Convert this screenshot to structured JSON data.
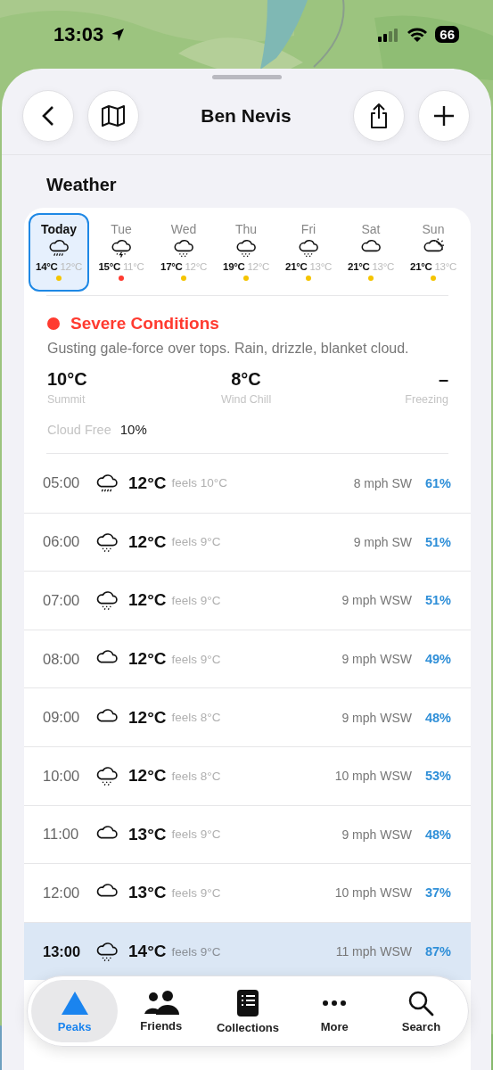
{
  "status_bar": {
    "time": "13:03",
    "battery": "66"
  },
  "header": {
    "title": "Ben Nevis"
  },
  "section_title": "Weather",
  "days": [
    {
      "label": "Today",
      "kind": "rain",
      "high": "14°C",
      "low": "12°C",
      "color": "#f5c400",
      "selected": true
    },
    {
      "label": "Tue",
      "kind": "thunder",
      "high": "15°C",
      "low": "11°C",
      "color": "#ff3b30",
      "selected": false
    },
    {
      "label": "Wed",
      "kind": "drizzle",
      "high": "17°C",
      "low": "12°C",
      "color": "#f5c400",
      "selected": false
    },
    {
      "label": "Thu",
      "kind": "drizzle",
      "high": "19°C",
      "low": "12°C",
      "color": "#f5c400",
      "selected": false
    },
    {
      "label": "Fri",
      "kind": "drizzle",
      "high": "21°C",
      "low": "13°C",
      "color": "#f5c400",
      "selected": false
    },
    {
      "label": "Sat",
      "kind": "cloud",
      "high": "21°C",
      "low": "13°C",
      "color": "#f5c400",
      "selected": false
    },
    {
      "label": "Sun",
      "kind": "partly-sunny",
      "high": "21°C",
      "low": "13°C",
      "color": "#f5c400",
      "selected": false
    }
  ],
  "conditions": {
    "title": "Severe Conditions",
    "color": "#ff3b30",
    "description": "Gusting gale-force over tops. Rain, drizzle, blanket cloud.",
    "stats": [
      {
        "value": "10°C",
        "label": "Summit"
      },
      {
        "value": "8°C",
        "label": "Wind Chill"
      },
      {
        "value": "–",
        "label": "Freezing"
      }
    ],
    "cloud_free_label": "Cloud Free",
    "cloud_free_value": "10%"
  },
  "hours": [
    {
      "time": "05:00",
      "kind": "rain",
      "temp": "12°C",
      "feels": "feels 10°C",
      "wind": "8 mph SW",
      "chance": "61%",
      "selected": false
    },
    {
      "time": "06:00",
      "kind": "drizzle",
      "temp": "12°C",
      "feels": "feels 9°C",
      "wind": "9 mph SW",
      "chance": "51%",
      "selected": false
    },
    {
      "time": "07:00",
      "kind": "drizzle",
      "temp": "12°C",
      "feels": "feels 9°C",
      "wind": "9 mph WSW",
      "chance": "51%",
      "selected": false
    },
    {
      "time": "08:00",
      "kind": "cloud",
      "temp": "12°C",
      "feels": "feels 9°C",
      "wind": "9 mph WSW",
      "chance": "49%",
      "selected": false
    },
    {
      "time": "09:00",
      "kind": "cloud",
      "temp": "12°C",
      "feels": "feels 8°C",
      "wind": "9 mph WSW",
      "chance": "48%",
      "selected": false
    },
    {
      "time": "10:00",
      "kind": "drizzle",
      "temp": "12°C",
      "feels": "feels 8°C",
      "wind": "10 mph WSW",
      "chance": "53%",
      "selected": false
    },
    {
      "time": "11:00",
      "kind": "cloud",
      "temp": "13°C",
      "feels": "feels 9°C",
      "wind": "9 mph WSW",
      "chance": "48%",
      "selected": false
    },
    {
      "time": "12:00",
      "kind": "cloud",
      "temp": "13°C",
      "feels": "feels 9°C",
      "wind": "10 mph WSW",
      "chance": "37%",
      "selected": false
    },
    {
      "time": "13:00",
      "kind": "drizzle",
      "temp": "14°C",
      "feels": "feels 9°C",
      "wind": "11 mph WSW",
      "chance": "87%",
      "selected": true
    }
  ],
  "tab_bar": [
    {
      "label": "Peaks",
      "kind": "triangle",
      "selected": true
    },
    {
      "label": "Friends",
      "kind": "people",
      "selected": false
    },
    {
      "label": "Collections",
      "kind": "list",
      "selected": false
    },
    {
      "label": "More",
      "kind": "dots",
      "selected": false
    },
    {
      "label": "Search",
      "kind": "search",
      "selected": false
    }
  ]
}
